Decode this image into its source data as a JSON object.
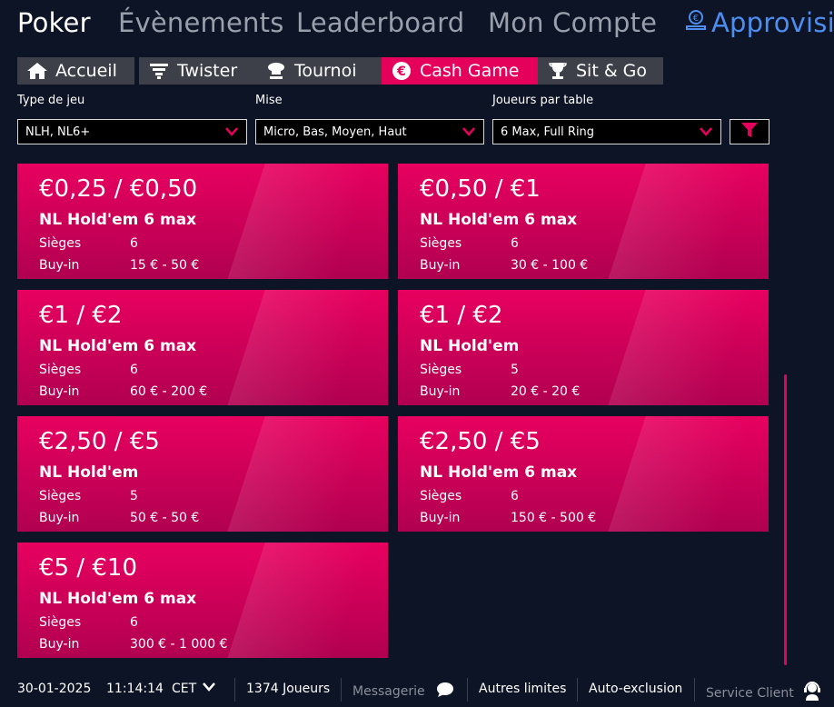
{
  "topnav": {
    "poker": "Poker",
    "events": "Évènements",
    "leaderboard": "Leaderboard",
    "account": "Mon Compte",
    "deposit": "Approvisi"
  },
  "subtabs": [
    {
      "label": "Accueil",
      "icon": "home-icon"
    },
    {
      "label": "Twister",
      "icon": "twister-icon"
    },
    {
      "label": "Tournoi",
      "icon": "tournament-icon"
    },
    {
      "label": "Cash Game",
      "icon": "euro-coin-icon",
      "active": true
    },
    {
      "label": "Sit & Go",
      "icon": "trophy-icon"
    }
  ],
  "filters": {
    "game_type": {
      "label": "Type de jeu",
      "value": "NLH, NL6+"
    },
    "stake": {
      "label": "Mise",
      "value": "Micro, Bas, Moyen, Haut"
    },
    "players": {
      "label": "Joueurs par table",
      "value": "6 Max, Full Ring"
    }
  },
  "cards": [
    {
      "stakes": "€0,25 / €0,50",
      "game": "NL Hold'em  6 max",
      "seats_label": "Sièges",
      "seats": "6",
      "buyin_label": "Buy-in",
      "buyin": "15 € - 50 €"
    },
    {
      "stakes": "€0,50 / €1",
      "game": "NL Hold'em  6 max",
      "seats_label": "Sièges",
      "seats": "6",
      "buyin_label": "Buy-in",
      "buyin": "30 € - 100 €"
    },
    {
      "stakes": "€1 / €2",
      "game": "NL Hold'em  6 max",
      "seats_label": "Sièges",
      "seats": "6",
      "buyin_label": "Buy-in",
      "buyin": "60 € - 200 €"
    },
    {
      "stakes": "€1 / €2",
      "game": "NL Hold'em",
      "seats_label": "Sièges",
      "seats": "5",
      "buyin_label": "Buy-in",
      "buyin": "20 € - 20 €"
    },
    {
      "stakes": "€2,50 / €5",
      "game": "NL Hold'em",
      "seats_label": "Sièges",
      "seats": "5",
      "buyin_label": "Buy-in",
      "buyin": "50 € - 50 €"
    },
    {
      "stakes": "€2,50 / €5",
      "game": "NL Hold'em  6 max",
      "seats_label": "Sièges",
      "seats": "6",
      "buyin_label": "Buy-in",
      "buyin": "150 € - 500 €"
    },
    {
      "stakes": "€5 / €10",
      "game": "NL Hold'em  6 max",
      "seats_label": "Sièges",
      "seats": "6",
      "buyin_label": "Buy-in",
      "buyin": "300 € - 1 000 €"
    }
  ],
  "footer": {
    "date": "30-01-2025",
    "time": "11:14:14",
    "tz": "CET",
    "players": "1374 Joueurs",
    "messages": "Messagerie",
    "limits": "Autres limites",
    "self_exclusion": "Auto-exclusion",
    "support": "Service Client"
  },
  "colors": {
    "accent": "#e5005c",
    "background": "#0d1426",
    "tab": "#3d4049",
    "link": "#4d8ef0"
  }
}
